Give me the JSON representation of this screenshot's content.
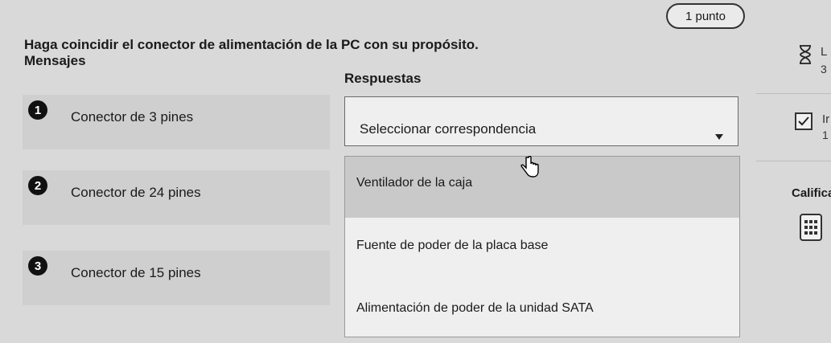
{
  "header": {
    "points": "1 punto",
    "question": "Haga coincidir el conector de alimentación de la PC con su propósito."
  },
  "messages": {
    "title": "Mensajes",
    "items": [
      {
        "num": "1",
        "label": "Conector de 3 pines"
      },
      {
        "num": "2",
        "label": "Conector de 24 pines"
      },
      {
        "num": "3",
        "label": "Conector de 15 pines"
      }
    ]
  },
  "responses": {
    "title": "Respuestas",
    "select_placeholder": "Seleccionar correspondencia",
    "options": [
      "Ventilador de la caja",
      "Fuente de poder de la placa base",
      "Alimentación de poder de la unidad SATA"
    ]
  },
  "side_panel": {
    "top_label": "L",
    "top_value": "3",
    "mid_label": "Ir",
    "mid_value": "1",
    "grade_label": "Califica"
  },
  "icons": {
    "hourglass": "hourglass-icon",
    "checkbox": "checkbox-checked-icon",
    "calculator": "calculator-icon",
    "cursor": "hand-cursor-icon",
    "caret": "caret-down-icon"
  }
}
